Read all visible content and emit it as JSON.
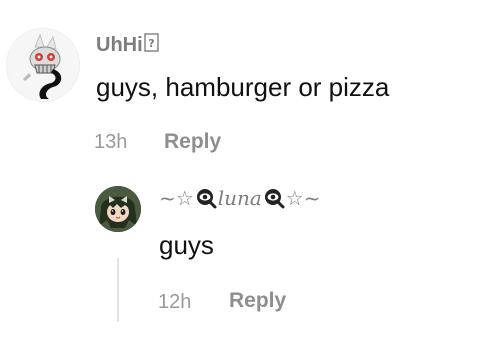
{
  "comments": [
    {
      "username": "UhHi",
      "text": "guys, hamburger or pizza",
      "time": "13h",
      "reply_label": "Reply",
      "avatar_icon": "robot-skull-avatar"
    },
    {
      "username": "~☆👁luna👁☆~",
      "username_parts": {
        "prefix": "~☆",
        "name": "luna",
        "suffix": "☆~"
      },
      "text": "guys",
      "time": "12h",
      "reply_label": "Reply",
      "avatar_icon": "anime-girl-avatar"
    }
  ],
  "colors": {
    "text": "#111111",
    "muted": "#9a9a9a",
    "username_gray": "#7d7d7d",
    "thread_line": "#e3e3e3"
  }
}
